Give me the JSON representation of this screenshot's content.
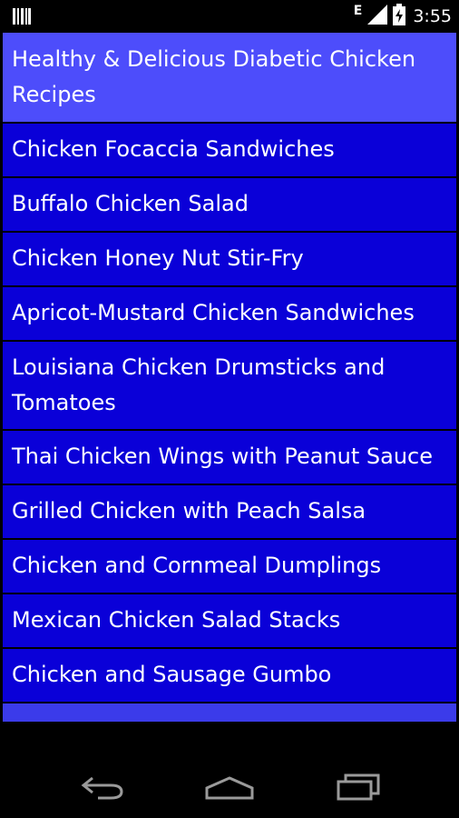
{
  "status_bar": {
    "network_type": "E",
    "time": "3:55"
  },
  "list": {
    "header": "Healthy & Delicious Diabetic Chicken Recipes",
    "items": [
      "Chicken Focaccia Sandwiches",
      "Buffalo Chicken Salad",
      "Chicken Honey Nut Stir-Fry",
      "Apricot-Mustard Chicken Sandwiches",
      "Louisiana Chicken Drumsticks and Tomatoes",
      "Thai Chicken Wings with Peanut Sauce",
      "Grilled Chicken with Peach Salsa",
      "Chicken and Cornmeal Dumplings",
      "Mexican Chicken Salad Stacks",
      "Chicken and Sausage Gumbo"
    ]
  },
  "colors": {
    "header_bg": "#4d4dfb",
    "item_bg": "#0a00d8",
    "text": "#ffffff"
  },
  "icons": {
    "status_left": "barcode-icon",
    "signal": "signal-icon",
    "battery": "battery-charging-icon",
    "nav_back": "back-icon",
    "nav_home": "home-icon",
    "nav_recents": "recents-icon"
  }
}
